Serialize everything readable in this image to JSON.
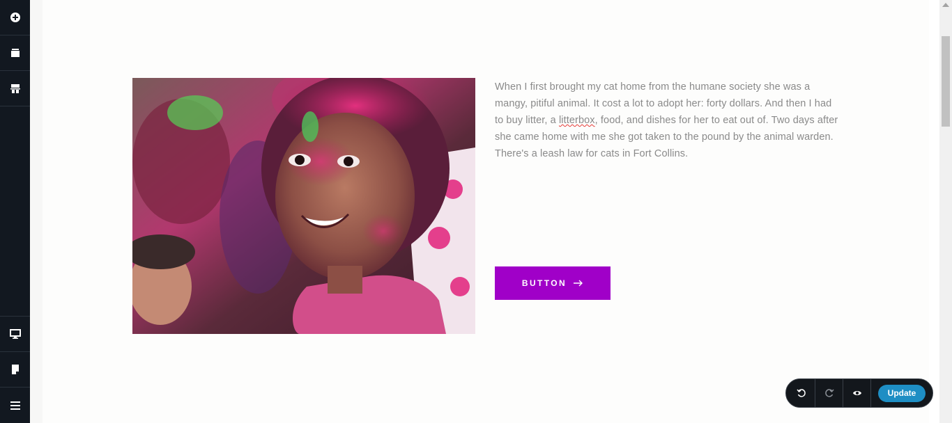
{
  "sidebar": {
    "top_icons": [
      "add-icon",
      "layers-icon",
      "layout-icon"
    ],
    "bottom_icons": [
      "desktop-preview-icon",
      "page-icon",
      "menu-icon"
    ]
  },
  "content": {
    "paragraph_before": "When I first brought my cat home from the humane society she was a mangy, pitiful animal. It cost a lot to adopt her: forty dollars. And then I had to buy litter, a ",
    "paragraph_misspelled": "litterbox",
    "paragraph_after": ", food, and dishes for her to eat out of. Two days after she came home with me she got taken to the pound by the animal warden. There's a leash law for cats in Fort Collins.",
    "button_label": "BUTTON",
    "image_alt": "Smiling girl with pink Holi powder on her face"
  },
  "toolbar": {
    "undo_icon": "undo-icon",
    "redo_icon": "redo-icon",
    "preview_icon": "eye-icon",
    "update_label": "Update"
  },
  "colors": {
    "sidebar_bg": "#121820",
    "button_bg": "#a000c8",
    "update_bg": "#1e8ec4",
    "text": "#8a8a8a"
  }
}
